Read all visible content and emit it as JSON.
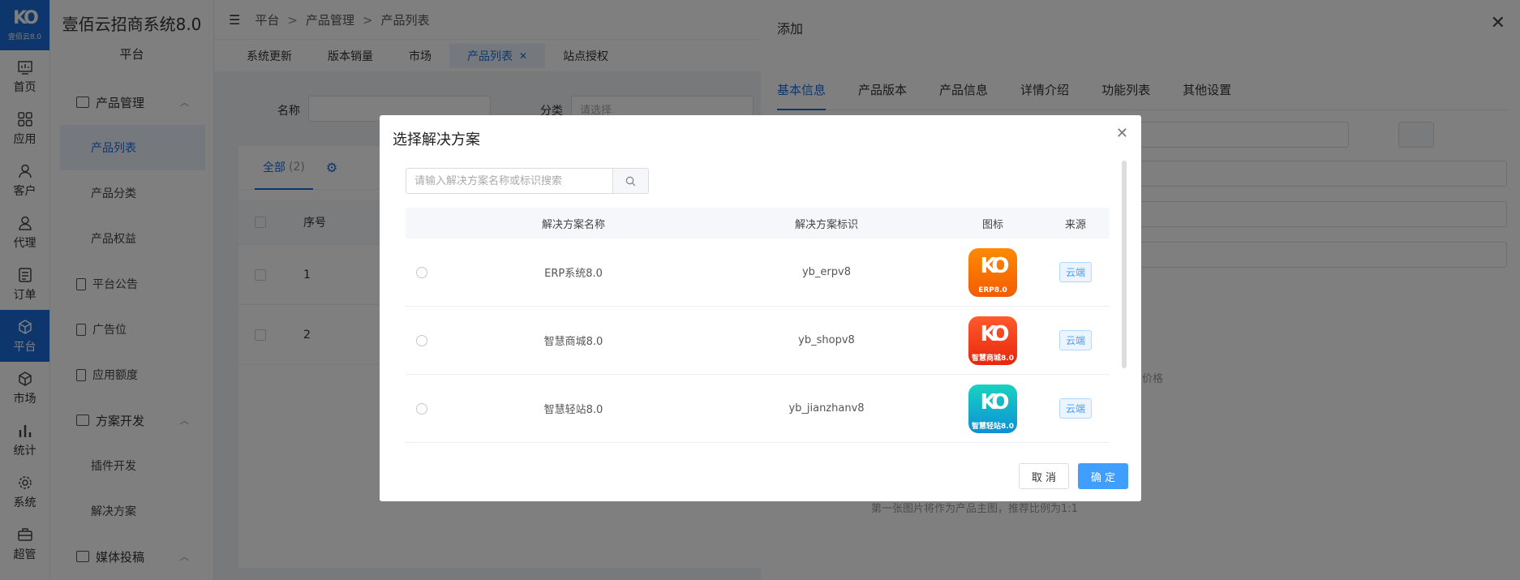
{
  "app": {
    "logo_sub": "壹佰云8.0",
    "title": "壹佰云招商系统8.0",
    "subtitle": "平台"
  },
  "rail": [
    {
      "label": "首页",
      "icon": "dashboard-icon"
    },
    {
      "label": "应用",
      "icon": "apps-icon"
    },
    {
      "label": "客户",
      "icon": "user-icon"
    },
    {
      "label": "代理",
      "icon": "agent-icon"
    },
    {
      "label": "订单",
      "icon": "order-icon"
    },
    {
      "label": "平台",
      "icon": "platform-icon"
    },
    {
      "label": "市场",
      "icon": "market-icon"
    },
    {
      "label": "统计",
      "icon": "chart-icon"
    },
    {
      "label": "系统",
      "icon": "gear-icon"
    },
    {
      "label": "超管",
      "icon": "briefcase-icon"
    }
  ],
  "sidebar": {
    "product_mgmt": "产品管理",
    "product_list": "产品列表",
    "product_category": "产品分类",
    "product_rights": "产品权益",
    "announcement": "平台公告",
    "ad_slot": "广告位",
    "app_quota": "应用额度",
    "solution_dev": "方案开发",
    "plugin_dev": "插件开发",
    "solution": "解决方案",
    "media": "媒体投稿"
  },
  "breadcrumb": [
    "平台",
    "产品管理",
    "产品列表"
  ],
  "tabs": [
    "系统更新",
    "版本销量",
    "市场",
    "产品列表",
    "站点授权"
  ],
  "filter": {
    "name_label": "名称",
    "category_label": "分类",
    "category_placeholder": "请选择"
  },
  "list": {
    "tab_all": "全部",
    "tab_count": "(2)",
    "col_index": "序号",
    "rows": [
      "1",
      "2"
    ]
  },
  "drawer": {
    "title": "添加",
    "tabs": [
      "基本信息",
      "产品版本",
      "产品信息",
      "详情介绍",
      "功能列表",
      "其他设置"
    ],
    "hint": "第一张图片将作为产品主图，推荐比例为1:1",
    "price_hint": "价格"
  },
  "modal": {
    "title": "选择解决方案",
    "search_placeholder": "请输入解决方案名称或标识搜索",
    "columns": [
      "解决方案名称",
      "解决方案标识",
      "图标",
      "来源"
    ],
    "rows": [
      {
        "name": "ERP系统8.0",
        "key": "yb_erpv8",
        "icon_text": "ERP8.0",
        "source": "云端",
        "color_top": "#ff8a00",
        "color_bottom": "#f25c05"
      },
      {
        "name": "智慧商城8.0",
        "key": "yb_shopv8",
        "icon_text": "智慧商城8.0",
        "source": "云端",
        "color_top": "#ff5a2c",
        "color_bottom": "#e8260e"
      },
      {
        "name": "智慧轻站8.0",
        "key": "yb_jianzhanv8",
        "icon_text": "智慧轻站8.0",
        "source": "云端",
        "color_top": "#19d2c0",
        "color_bottom": "#0c8fd6"
      }
    ],
    "cancel": "取 消",
    "ok": "确 定"
  },
  "colors": {
    "primary": "#1b6fd8",
    "accent": "#409eff"
  }
}
